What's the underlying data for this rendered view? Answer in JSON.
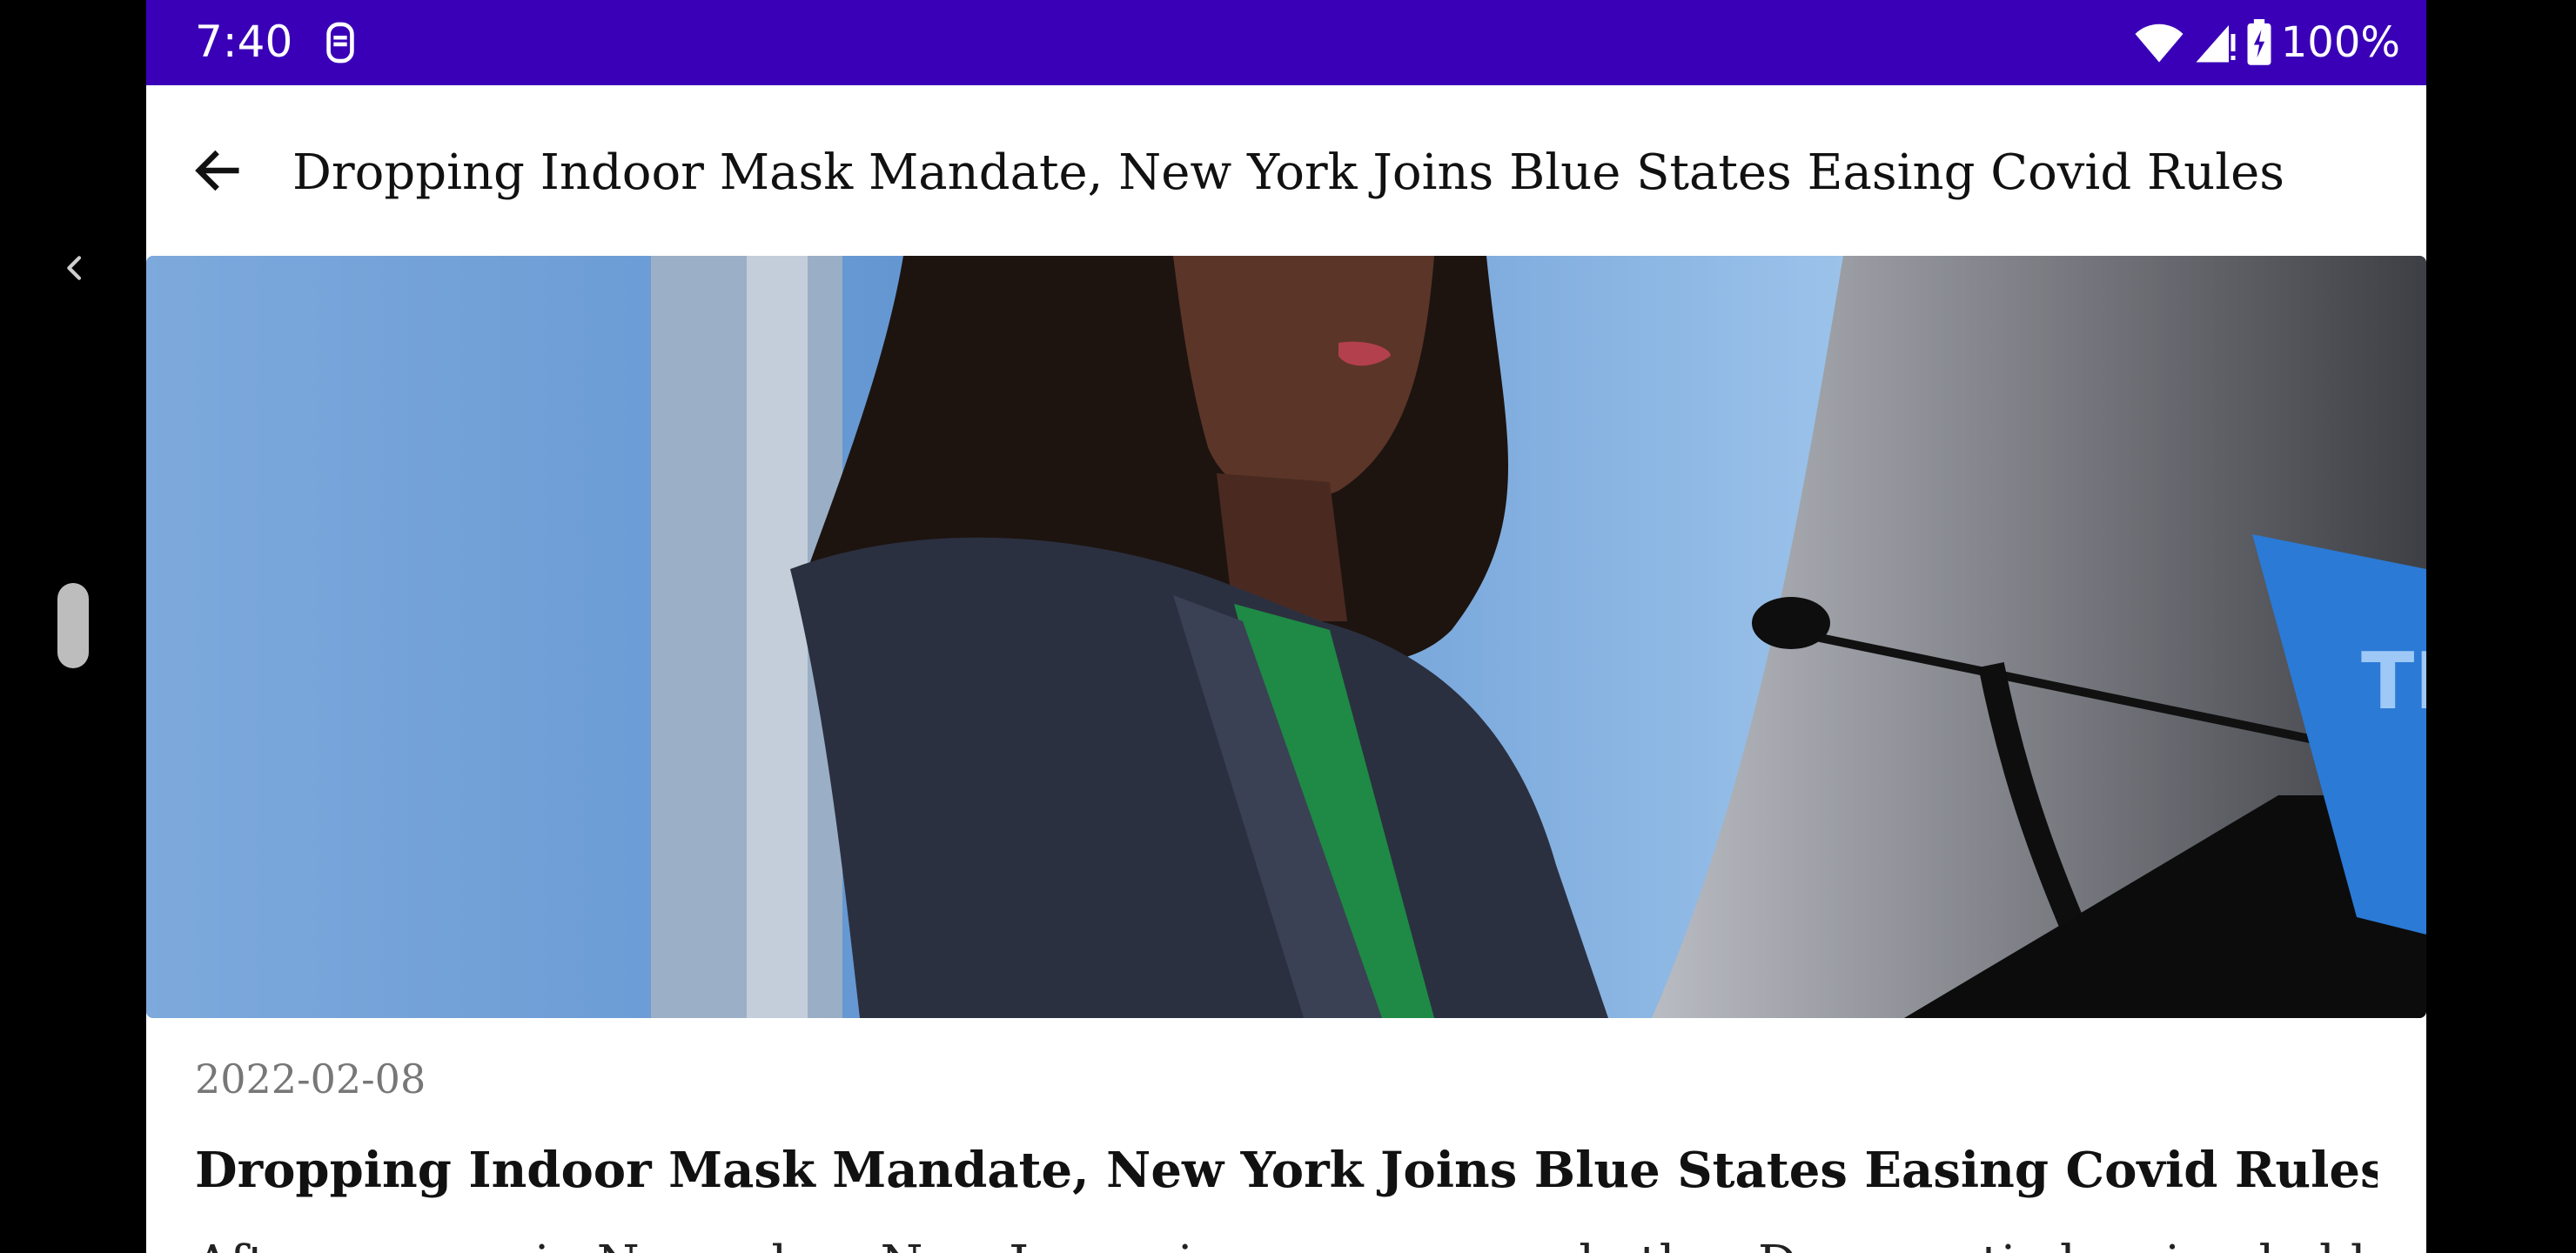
{
  "status_bar": {
    "time": "7:40",
    "battery_percent": "100%",
    "icons": [
      "data-saver-icon",
      "wifi-icon",
      "cell-signal-icon",
      "battery-charging-icon"
    ]
  },
  "app_bar": {
    "title": "Dropping Indoor Mask Mandate, New York Joins Blue States Easing Covid Rules",
    "back_icon": "arrow-back-icon"
  },
  "article": {
    "date": "2022-02-08",
    "headline": "Dropping Indoor Mask Mandate, New York Joins Blue States Easing Covid Rules",
    "body_first_line_partial": "After a surge in November, New Jersey is among several other Democratic-leaning holdouts"
  },
  "colors": {
    "status_bar": "#3a00b8",
    "background": "#ffffff",
    "date_text": "#777777"
  }
}
